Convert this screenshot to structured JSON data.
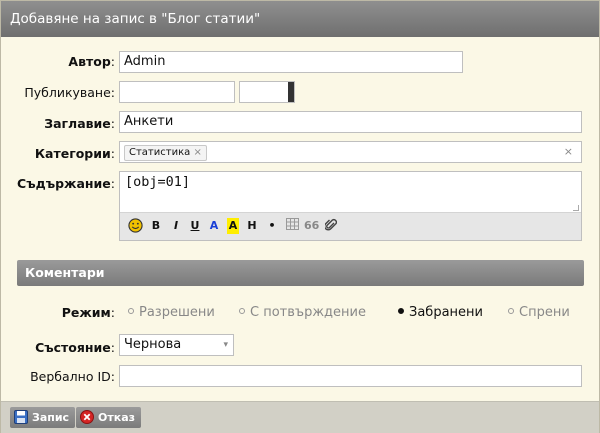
{
  "dialog": {
    "title": "Добавяне на запис в \"Блог статии\""
  },
  "form": {
    "author": {
      "label": "Автор",
      "value": "Admin"
    },
    "publish": {
      "label": "Публикуване:",
      "date_value": "",
      "time_value": ""
    },
    "title": {
      "label": "Заглавие",
      "value": "Анкети"
    },
    "categories": {
      "label": "Категории",
      "tags": [
        "Статистика"
      ],
      "tag_remove": "×",
      "clear": "×"
    },
    "content": {
      "label": "Съдържание",
      "value": "[obj=01]",
      "toolbar": {
        "bold": "B",
        "italic": "I",
        "underline": "U",
        "color": "A",
        "highlight": "A",
        "heading": "H",
        "bullet": "•",
        "quote": "66"
      }
    },
    "colon": ":"
  },
  "comments": {
    "section_title": "Коментари",
    "mode": {
      "label": "Режим",
      "options": [
        "Разрешени",
        "С потвърждение",
        "Забранени",
        "Спрени"
      ],
      "selected": "Забранени"
    },
    "state": {
      "label": "Състояние",
      "value": "Чернова",
      "arrow": "▾"
    },
    "verbal_id": {
      "label": "Вербално ID:",
      "value": ""
    }
  },
  "buttons": {
    "save": "Запис",
    "cancel": "Отказ"
  },
  "colors": {
    "title_bg": "#7f7f7f",
    "panel_bg": "#fbf8e6",
    "highlight": "#ffee00",
    "blue": "#1a3fd6"
  }
}
